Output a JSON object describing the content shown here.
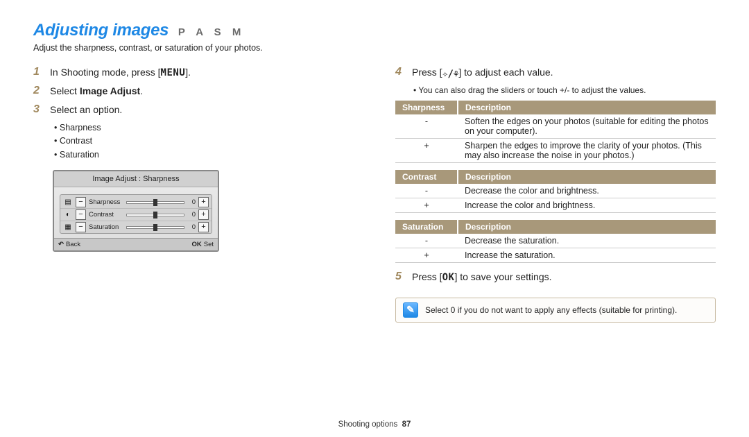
{
  "header": {
    "title": "Adjusting images",
    "modes": "P A S M",
    "subtitle": "Adjust the sharpness, contrast, or saturation of your photos."
  },
  "left": {
    "step1": {
      "num": "1",
      "text_before": "In Shooting mode, press [",
      "code": "MENU",
      "text_after": "]."
    },
    "step2": {
      "num": "2",
      "text_before": "Select ",
      "bold": "Image Adjust",
      "text_after": "."
    },
    "step3": {
      "num": "3",
      "text": "Select an option.",
      "bullets": [
        "Sharpness",
        "Contrast",
        "Saturation"
      ]
    },
    "camera": {
      "title": "Image Adjust : Sharpness",
      "rows": [
        {
          "icon": "▤",
          "label": "Sharpness",
          "value": "0"
        },
        {
          "icon": "◐",
          "label": "Contrast",
          "value": "0"
        },
        {
          "icon": "▦",
          "label": "Saturation",
          "value": "0"
        }
      ],
      "footer_back": "Back",
      "footer_back_icon": "↶",
      "footer_set": "Set",
      "footer_set_icon": "OK"
    }
  },
  "right": {
    "step4": {
      "num": "4",
      "text_before": "Press [",
      "code": "✧/⚘",
      "text_after": "] to adjust each value.",
      "note": "You can also drag the sliders or touch +/- to adjust the values."
    },
    "table_sharpness": {
      "h1": "Sharpness",
      "h2": "Description",
      "rows": [
        {
          "k": "-",
          "v": "Soften the edges on your photos (suitable for editing the photos on your computer)."
        },
        {
          "k": "+",
          "v": "Sharpen the edges to improve the clarity of your photos. (This may also increase the noise in your photos.)"
        }
      ]
    },
    "table_contrast": {
      "h1": "Contrast",
      "h2": "Description",
      "rows": [
        {
          "k": "-",
          "v": "Decrease the color and brightness."
        },
        {
          "k": "+",
          "v": "Increase the color and brightness."
        }
      ]
    },
    "table_saturation": {
      "h1": "Saturation",
      "h2": "Description",
      "rows": [
        {
          "k": "-",
          "v": "Decrease the saturation."
        },
        {
          "k": "+",
          "v": "Increase the saturation."
        }
      ]
    },
    "step5": {
      "num": "5",
      "text_before": "Press [",
      "code": "OK",
      "text_after": "] to save your settings."
    },
    "tip": "Select 0 if you do not want to apply any effects (suitable for printing)."
  },
  "footer": {
    "section": "Shooting options",
    "page": "87"
  }
}
